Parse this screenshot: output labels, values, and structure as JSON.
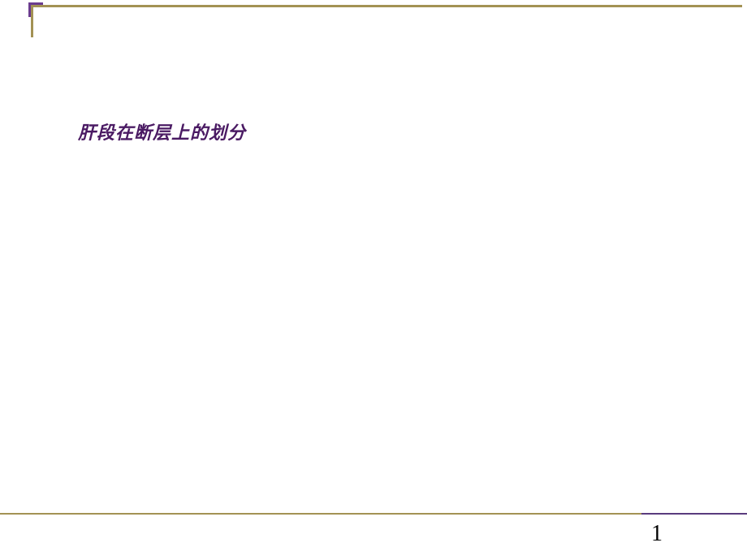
{
  "slide": {
    "title": "肝段在断层上的划分",
    "page_number": "1"
  }
}
